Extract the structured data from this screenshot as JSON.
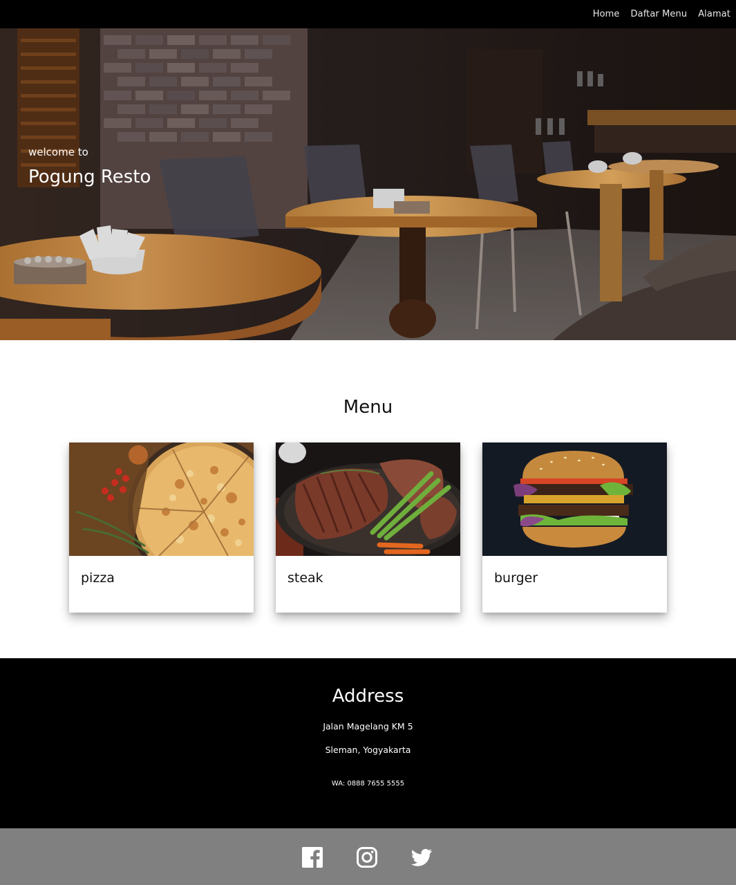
{
  "nav": {
    "items": [
      {
        "label": "Home"
      },
      {
        "label": "Daftar Menu"
      },
      {
        "label": "Alamat"
      }
    ]
  },
  "hero": {
    "welcome": "welcome to",
    "title": "Pogung Resto",
    "image": "restaurant-interior-photo"
  },
  "menu": {
    "title": "Menu",
    "items": [
      {
        "name": "pizza",
        "image": "pizza-photo"
      },
      {
        "name": "steak",
        "image": "steak-photo"
      },
      {
        "name": "burger",
        "image": "burger-photo"
      }
    ]
  },
  "address": {
    "title": "Address",
    "line1": "Jalan Magelang KM 5",
    "line2": "Sleman, Yogyakarta",
    "wa": "WA: 0888 7655 5555"
  },
  "social": {
    "icons": [
      "facebook-icon",
      "instagram-icon",
      "twitter-icon"
    ],
    "background": "#808080"
  },
  "colors": {
    "nav_bg": "#000000",
    "footer_bg": "#000000",
    "text_light": "#ffffff"
  }
}
